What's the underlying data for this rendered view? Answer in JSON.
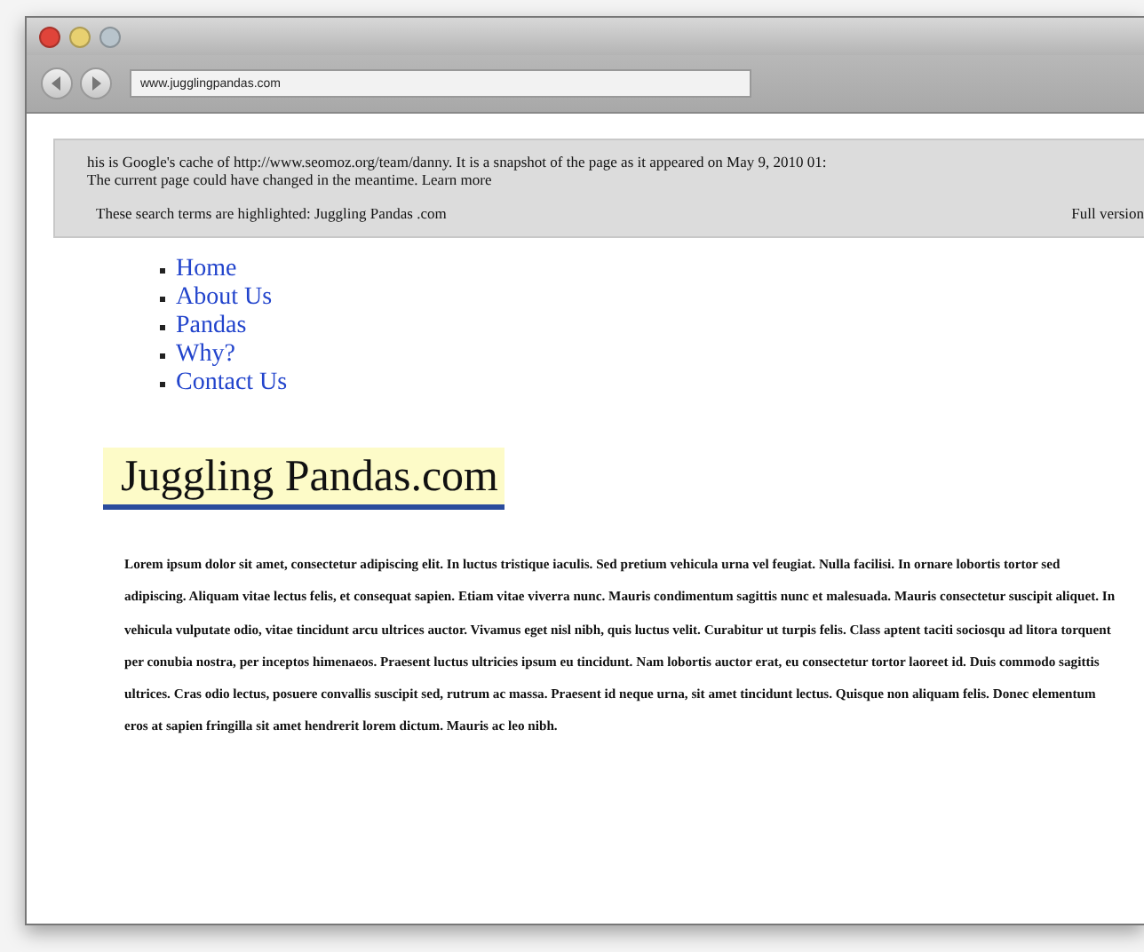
{
  "address_bar": {
    "url": "www.jugglingpandas.com"
  },
  "cache_banner": {
    "lines": [
      "his is Google's cache of http://www.seomoz.org/team/danny. It is a snapshot of the page as it appeared on May 9, 2010 01:",
      "The current page  could have changed in the meantime. Learn more"
    ],
    "terms": "These search terms are highlighted: Juggling Pandas .com",
    "full_version": "Full version"
  },
  "nav": [
    "Home",
    "About Us",
    "Pandas",
    "Why?",
    "Contact Us"
  ],
  "site_title": "Juggling Pandas.com",
  "body": "Lorem ipsum dolor sit amet, consectetur adipiscing elit. In luctus tristique iaculis. Sed pretium vehicula urna vel feugiat. Nulla facilisi. In ornare lobortis tortor sed adipiscing. Aliquam vitae lectus felis, et consequat sapien. Etiam vitae viverra nunc. Mauris condimentum sagittis nunc et malesuada. Mauris consectetur suscipit aliquet. In vehicula vulputate odio, vitae tincidunt arcu ultrices auctor. Vivamus eget nisl nibh, quis luctus velit. Curabitur ut turpis felis. Class aptent taciti sociosqu ad litora torquent per conubia nostra, per inceptos himenaeos. Praesent luctus ultricies ipsum eu tincidunt. Nam lobortis auctor erat, eu consectetur tortor laoreet id. Duis commodo sagittis ultrices. Cras odio lectus, posuere convallis suscipit sed, rutrum ac massa. Praesent id neque urna, sit amet tincidunt lectus. Quisque non aliquam felis. Donec elementum eros at sapien fringilla sit amet hendrerit lorem dictum. Mauris ac leo nibh."
}
